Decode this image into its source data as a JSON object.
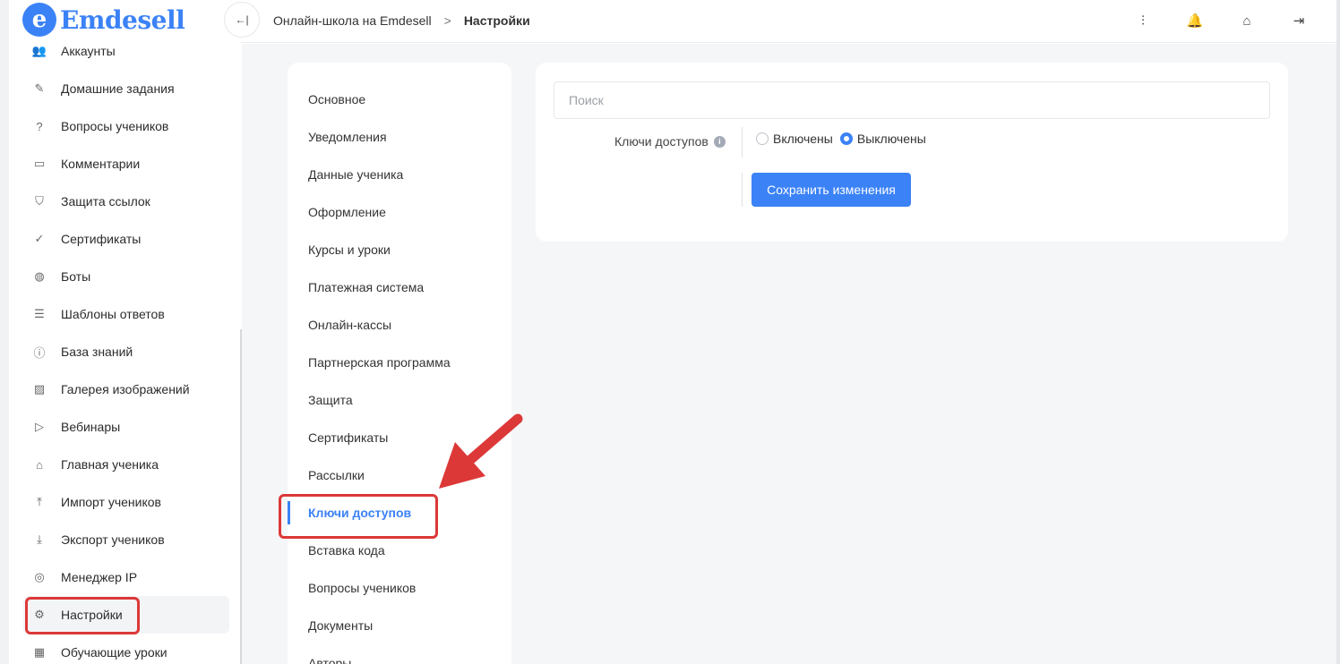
{
  "app": {
    "logo_letter": "e",
    "logo_text": "Emdesell"
  },
  "sidebar": {
    "items": [
      {
        "label": "Аккаунты",
        "icon": "users-icon",
        "glyph": "👥",
        "active": false
      },
      {
        "label": "Домашние задания",
        "icon": "pencil-icon",
        "glyph": "✎",
        "active": false
      },
      {
        "label": "Вопросы учеников",
        "icon": "question-icon",
        "glyph": "?",
        "active": false
      },
      {
        "label": "Комментарии",
        "icon": "comment-icon",
        "glyph": "▭",
        "active": false
      },
      {
        "label": "Защита ссылок",
        "icon": "shield-icon",
        "glyph": "⛉",
        "active": false
      },
      {
        "label": "Сертификаты",
        "icon": "certificate-icon",
        "glyph": "✓",
        "active": false
      },
      {
        "label": "Боты",
        "icon": "bot-icon",
        "glyph": "◍",
        "active": false
      },
      {
        "label": "Шаблоны ответов",
        "icon": "list-icon",
        "glyph": "☰",
        "active": false
      },
      {
        "label": "База знаний",
        "icon": "info-icon",
        "glyph": "ⓘ",
        "active": false
      },
      {
        "label": "Галерея изображений",
        "icon": "image-icon",
        "glyph": "▨",
        "active": false
      },
      {
        "label": "Вебинары",
        "icon": "play-icon",
        "glyph": "▷",
        "active": false
      },
      {
        "label": "Главная ученика",
        "icon": "home-icon",
        "glyph": "⌂",
        "active": false
      },
      {
        "label": "Импорт учеников",
        "icon": "upload-icon",
        "glyph": "⤒",
        "active": false
      },
      {
        "label": "Экспорт учеников",
        "icon": "download-icon",
        "glyph": "⤓",
        "active": false
      },
      {
        "label": "Менеджер IP",
        "icon": "target-icon",
        "glyph": "◎",
        "active": false
      },
      {
        "label": "Настройки",
        "icon": "gear-icon",
        "glyph": "⚙",
        "active": true
      },
      {
        "label": "Обучающие уроки",
        "icon": "film-icon",
        "glyph": "▦",
        "active": false
      }
    ]
  },
  "topbar": {
    "collapse_glyph": "←|",
    "breadcrumb": {
      "parent": "Онлайн-школа на Emdesell",
      "separator": ">",
      "current": "Настройки"
    },
    "icons": [
      {
        "name": "sliders-icon",
        "glyph": "⫶"
      },
      {
        "name": "bell-icon",
        "glyph": "🔔"
      },
      {
        "name": "home-settings-icon",
        "glyph": "⌂"
      },
      {
        "name": "logout-icon",
        "glyph": "⇥"
      }
    ]
  },
  "settings_nav": {
    "items": [
      {
        "label": "Основное",
        "active": false
      },
      {
        "label": "Уведомления",
        "active": false
      },
      {
        "label": "Данные ученика",
        "active": false
      },
      {
        "label": "Оформление",
        "active": false
      },
      {
        "label": "Курсы и уроки",
        "active": false
      },
      {
        "label": "Платежная система",
        "active": false
      },
      {
        "label": "Онлайн-кассы",
        "active": false
      },
      {
        "label": "Партнерская программа",
        "active": false
      },
      {
        "label": "Защита",
        "active": false
      },
      {
        "label": "Сертификаты",
        "active": false
      },
      {
        "label": "Рассылки",
        "active": false
      },
      {
        "label": "Ключи доступов",
        "active": true
      },
      {
        "label": "Вставка кода",
        "active": false
      },
      {
        "label": "Вопросы учеников",
        "active": false
      },
      {
        "label": "Документы",
        "active": false
      },
      {
        "label": "Авторы",
        "active": false
      }
    ]
  },
  "panel": {
    "search_placeholder": "Поиск",
    "field_label": "Ключи доступов",
    "info_glyph": "i",
    "radio_on_label": "Включены",
    "radio_off_label": "Выключены",
    "selected": "Выключены",
    "save_label": "Сохранить изменения"
  },
  "colors": {
    "accent": "#3b82f6",
    "annotation": "#dc3838"
  }
}
